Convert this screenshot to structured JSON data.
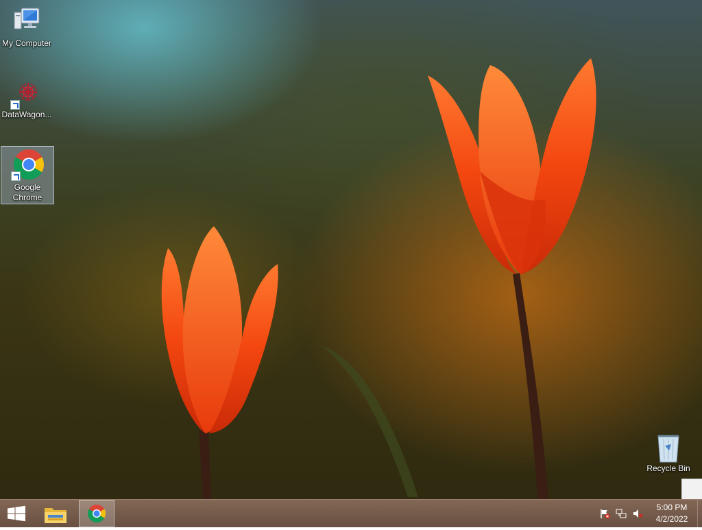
{
  "desktop": {
    "icons": [
      {
        "label": "My Computer",
        "icon": "computer-icon"
      },
      {
        "label": "DataWagon...",
        "icon": "datawagon-icon"
      },
      {
        "label": "Google Chrome",
        "icon": "chrome-icon",
        "selected": true
      }
    ],
    "recycle_bin": {
      "label": "Recycle Bin",
      "icon": "recycle-bin-icon"
    }
  },
  "taskbar": {
    "start_icon": "windows-start-icon",
    "pinned": [
      {
        "name": "File Explorer",
        "icon": "file-explorer-icon"
      },
      {
        "name": "Google Chrome",
        "icon": "chrome-icon",
        "active": true
      }
    ],
    "tray": {
      "icons": [
        "action-center-flag-icon",
        "network-icon",
        "volume-muted-icon"
      ],
      "time": "5:00 PM",
      "date": "4/2/2022"
    }
  },
  "colors": {
    "taskbar": "#6e5242",
    "tulip": "#ff4a10",
    "chrome_red": "#db4437",
    "chrome_yellow": "#f4c20d",
    "chrome_green": "#0f9d58",
    "chrome_blue": "#4285f4"
  }
}
